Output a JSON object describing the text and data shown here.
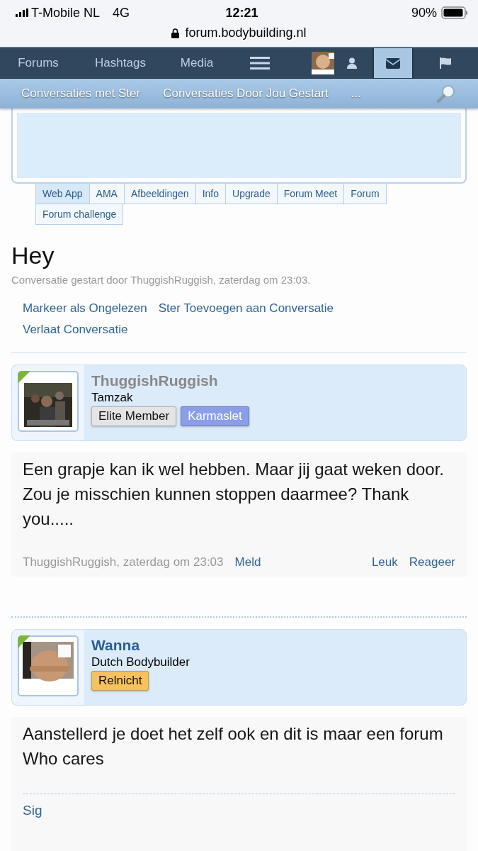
{
  "status_bar": {
    "carrier": "T-Mobile NL",
    "network": "4G",
    "time": "12:21",
    "battery": "90%"
  },
  "url": "forum.bodybuilding.nl",
  "nav": [
    {
      "kind": "text",
      "label": "Forums",
      "selected": false
    },
    {
      "kind": "text",
      "label": "Hashtags",
      "selected": false
    },
    {
      "kind": "text",
      "label": "Media",
      "selected": false
    },
    {
      "kind": "menu",
      "selected": false
    },
    {
      "kind": "account",
      "selected": false
    },
    {
      "kind": "inbox",
      "selected": true
    },
    {
      "kind": "alerts",
      "selected": false
    }
  ],
  "subnav": [
    "Conversaties met Ster",
    "Conversaties Door Jou Gestart",
    "..."
  ],
  "tabs": [
    {
      "label": "Web App",
      "selected": true
    },
    {
      "label": "AMA",
      "selected": false
    },
    {
      "label": "Afbeeldingen",
      "selected": false
    },
    {
      "label": "Info",
      "selected": false
    },
    {
      "label": "Upgrade",
      "selected": false
    },
    {
      "label": "Forum Meet",
      "selected": false
    },
    {
      "label": "Forum",
      "selected": false
    },
    {
      "label": "Forum challenge",
      "selected": false
    }
  ],
  "title": "Hey",
  "byline": "Conversatie gestart door ThuggishRuggish, zaterdag om 23:03.",
  "actions": [
    "Markeer als Ongelezen",
    "Ster Toevoegen aan Conversatie",
    "Verlaat Conversatie"
  ],
  "posts": [
    {
      "author": "ThuggishRuggish",
      "color": "#888888",
      "title": "Tamzak",
      "badges": [
        {
          "label": "Elite Member",
          "color": "#e4e4e4"
        },
        {
          "label": "Karmaslet",
          "color": "#8c9ee8"
        }
      ],
      "body": [
        "Een grapje kan ik wel hebben. Maar jij gaat weken door. Zou je misschien kunnen stoppen daarmee? Thank you....."
      ],
      "footer": {
        "meta": "ThuggishRuggish, zaterdag om 23:03",
        "links": [
          "Meld"
        ],
        "right": [
          "Leuk",
          "Reageer"
        ]
      }
    },
    {
      "author": "Wanna",
      "color": "#2b5d93",
      "title": "Dutch Bodybuilder",
      "badges": [
        {
          "label": "Relnicht",
          "color": "#f7c25c"
        }
      ],
      "body": [
        "Aanstellerd je doet het zelf ook en dit is maar een forum",
        "Who cares"
      ],
      "signature": "Sig"
    }
  ]
}
